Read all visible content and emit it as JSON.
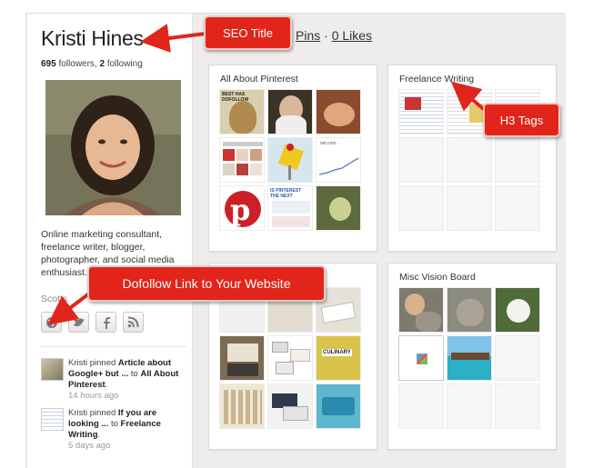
{
  "profile": {
    "name": "Kristi Hines",
    "followers_count": "695",
    "followers_label": "followers,",
    "following_count": "2",
    "following_label": "following",
    "bio": "Online marketing consultant, freelance writer, blogger, photographer, and social media enthusiast. Also enjoy hiking, and",
    "location": "Scotts"
  },
  "nav": {
    "pins_label": "Pins",
    "separator": "·",
    "likes_label": "0 Likes"
  },
  "social": [
    "globe-icon",
    "twitter-icon",
    "facebook-icon",
    "rss-icon"
  ],
  "activity": [
    {
      "prefix": "Kristi pinned ",
      "item": "Article about Google+ but ...",
      "middle": " to ",
      "board": "All About Pinterest",
      "suffix": ".",
      "time": "14 hours ago"
    },
    {
      "prefix": "Kristi pinned ",
      "item": "If you are looking ...",
      "middle": " to ",
      "board": "Freelance Writing",
      "suffix": ".",
      "time": "5 days ago"
    }
  ],
  "boards": [
    {
      "title": "All About Pinterest"
    },
    {
      "title": "Freelance Writing"
    },
    {
      "title": ""
    },
    {
      "title": "Misc Vision Board"
    }
  ],
  "thumb_text": {
    "pinterest_headline": "BEST HAS DOFOLLOW",
    "is_pinterest": "IS PINTEREST THE NEXT",
    "culinary": "CULINARY"
  },
  "callouts": {
    "seo_title": "SEO Title",
    "h3_tags": "H3 Tags",
    "dofollow": "Dofollow Link to Your Website"
  },
  "colors": {
    "callout_red": "#e1251b",
    "page_bg": "#efecec",
    "pinterest_red": "#cb2027"
  }
}
